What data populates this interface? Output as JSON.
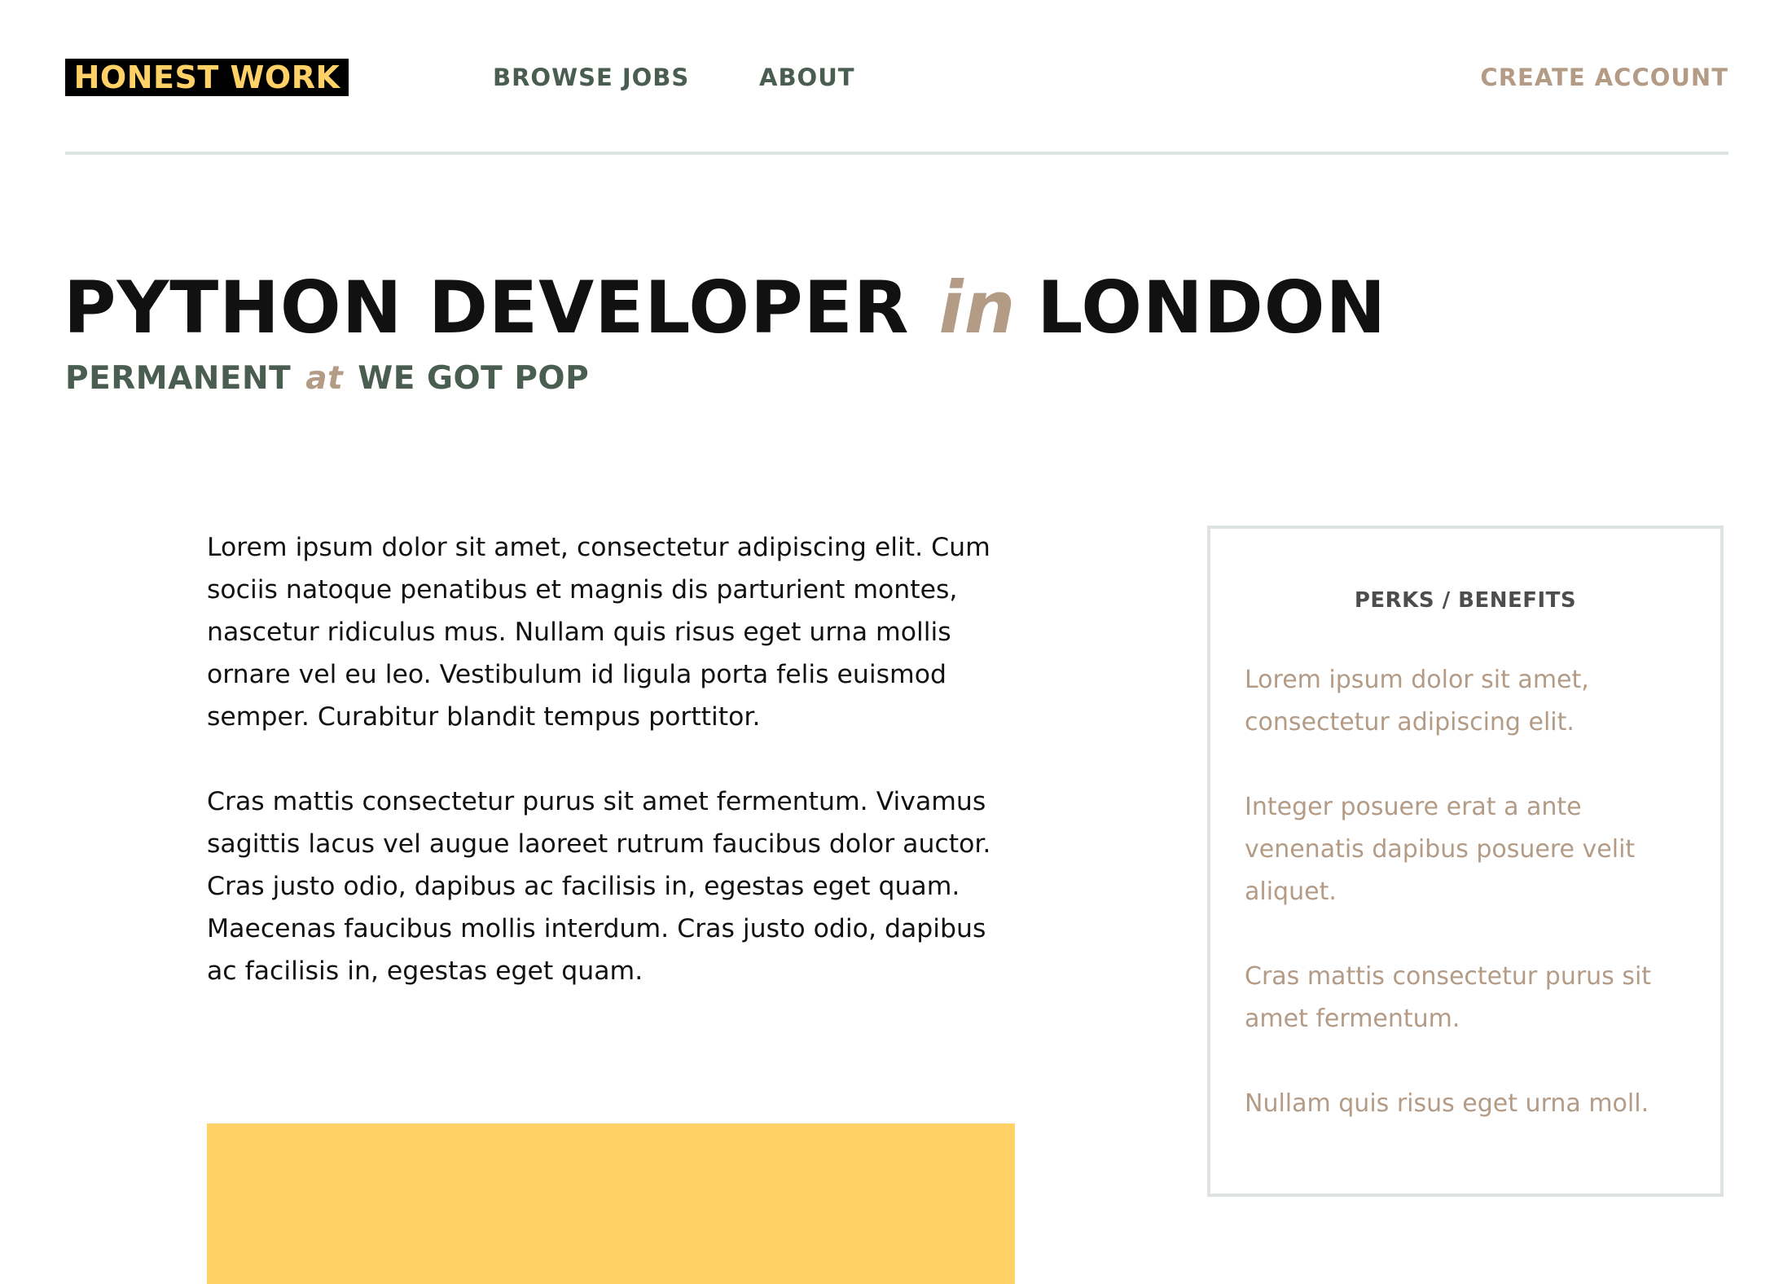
{
  "header": {
    "logo": "HONEST WORK",
    "nav": [
      {
        "label": "BROWSE JOBS"
      },
      {
        "label": "ABOUT"
      }
    ],
    "create_account": "CREATE ACCOUNT"
  },
  "job": {
    "title": "PYTHON DEVELOPER",
    "connector_in": "in",
    "location": "LONDON",
    "type": "PERMANENT",
    "connector_at": "at",
    "company": "WE GOT POP"
  },
  "description": {
    "paragraphs": [
      "Lorem ipsum dolor sit amet, consectetur adipiscing elit. Cum sociis natoque penatibus et magnis dis parturient montes, nascetur ridiculus mus. Nullam quis risus eget urna mollis ornare vel eu leo. Vestibulum id ligula porta felis euismod semper. Curabitur blandit tempus porttitor.",
      "Cras mattis consectetur purus sit amet fermentum. Vivamus sagittis lacus vel augue laoreet rutrum faucibus dolor auctor. Cras justo odio, dapibus ac facilisis in, egestas eget quam. Maecenas faucibus mollis interdum. Cras justo odio, dapibus ac facilisis in, egestas eget quam."
    ]
  },
  "perks": {
    "title": "PERKS / BENEFITS",
    "items": [
      "Lorem ipsum dolor sit amet, consectetur adipiscing elit.",
      "Integer posuere erat a ante venenatis dapibus posuere velit aliquet.",
      "Cras mattis consectetur purus sit amet fermentum.",
      "Nullam quis risus eget urna moll."
    ]
  },
  "colors": {
    "logo_background": "#000000",
    "logo_text": "#ffd166",
    "nav_green": "#4a5d51",
    "accent_tan": "#b39b86",
    "title_black": "#111111",
    "divider": "#dde3e2",
    "cta_yellow": "#ffd166"
  }
}
